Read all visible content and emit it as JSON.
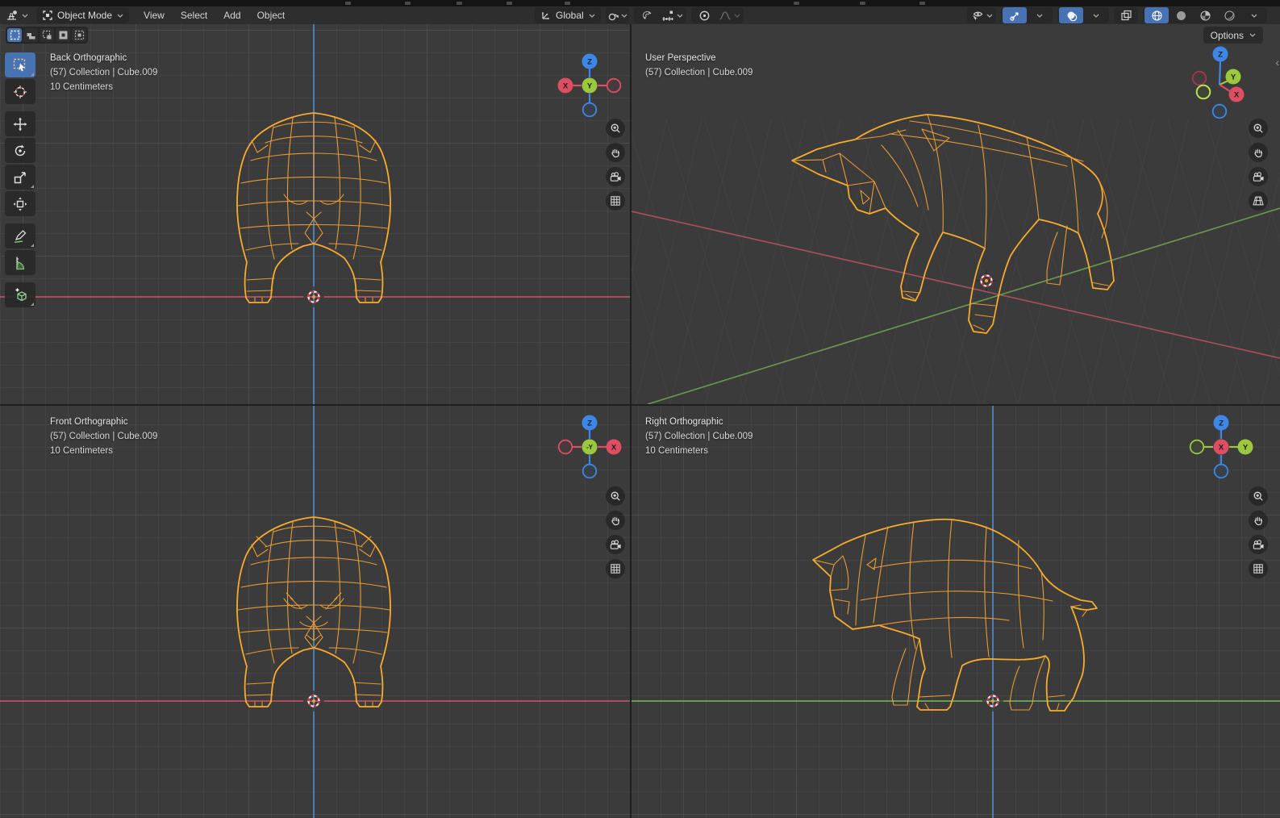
{
  "header": {
    "mode_label": "Object Mode",
    "menus": [
      {
        "label": "View"
      },
      {
        "label": "Select"
      },
      {
        "label": "Add"
      },
      {
        "label": "Object"
      }
    ],
    "orientation_label": "Global",
    "options_label": "Options",
    "icons": [
      "editor-type-3d-viewport",
      "object-mode",
      "transform-orientation",
      "pivot-point",
      "snap-magnet",
      "snap-target-increment",
      "proportional-editing",
      "proportional-falloff",
      "show-object-types",
      "show-gizmo",
      "show-overlays",
      "toggle-xray",
      "shading-wireframe",
      "shading-solid",
      "shading-material-preview",
      "shading-rendered"
    ]
  },
  "tool_settings": {
    "select_mode_icons": [
      "select-set",
      "select-extend",
      "select-subtract",
      "select-invert",
      "select-intersect"
    ],
    "active_mode_index": 0
  },
  "toolbar": {
    "tools": [
      {
        "icon": "select-box",
        "active": true
      },
      {
        "icon": "cursor"
      },
      {
        "icon": "move"
      },
      {
        "icon": "rotate"
      },
      {
        "icon": "scale"
      },
      {
        "icon": "transform"
      },
      {
        "icon": "annotate"
      },
      {
        "icon": "measure"
      },
      {
        "icon": "add-cube"
      }
    ]
  },
  "viewports": {
    "back": {
      "title": "Back Orthographic",
      "subtitle": "(57) Collection | Cube.009",
      "scale": "10 Centimeters"
    },
    "persp": {
      "title": "User Perspective",
      "subtitle": "(57) Collection | Cube.009"
    },
    "front": {
      "title": "Front Orthographic",
      "subtitle": "(57) Collection | Cube.009",
      "scale": "10 Centimeters"
    },
    "right": {
      "title": "Right Orthographic",
      "subtitle": "(57) Collection | Cube.009",
      "scale": "10 Centimeters"
    }
  },
  "gizmo_axes": {
    "back": {
      "up": "Z",
      "left": "X",
      "center": "Y"
    },
    "persp": {
      "up": "Z",
      "x": "X",
      "y": "Y"
    },
    "front": {
      "up": "Z",
      "right": "X",
      "center": "-Y"
    },
    "right": {
      "up": "Z",
      "right": "Y",
      "center": "X"
    }
  },
  "nav_icons": [
    "zoom-in",
    "pan",
    "camera-view",
    "grid-ortho-toggle"
  ],
  "colors": {
    "accent": "#4772b3",
    "wireframe": "#f09f34",
    "wireframe_bright": "#f8ab2e",
    "axis_x": "#a8505b",
    "axis_y": "#6a9b50",
    "axis_z": "#4f7cb3",
    "gizmo_x": "#dd4e62",
    "gizmo_y": "#9bc83d",
    "gizmo_z": "#3d87e8",
    "viewport_bg": "#3b3b3b",
    "grid_line": "#434343",
    "grid_line_major": "#4a4a4a",
    "header_bg": "#2e2e2e",
    "button_bg": "#282828",
    "panel_text": "#d9d9d9",
    "cursor_red": "#c9353f"
  }
}
